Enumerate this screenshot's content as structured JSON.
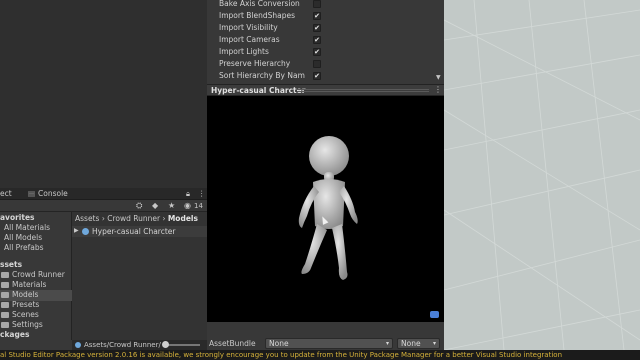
{
  "inspector": {
    "rows": [
      {
        "label": "Bake Axis Conversion",
        "checked": false
      },
      {
        "label": "Import BlendShapes",
        "checked": true
      },
      {
        "label": "Import Visibility",
        "checked": true
      },
      {
        "label": "Import Cameras",
        "checked": true
      },
      {
        "label": "Import Lights",
        "checked": true
      },
      {
        "label": "Preserve Hierarchy",
        "checked": false
      },
      {
        "label": "Sort Hierarchy By Nam",
        "checked": true
      }
    ],
    "check_glyph": "✔"
  },
  "preview": {
    "title": "Hyper-casual Charcter",
    "menu_icon": "⋮",
    "corner_icon": "preview-settings-icon"
  },
  "asset_bundle": {
    "label": "AssetBundle",
    "name_value": "None",
    "variant_value": "None",
    "caret": "▾"
  },
  "project": {
    "tabs": [
      "ect",
      "Console"
    ],
    "toolbar": {
      "visibility_count": "14"
    },
    "tree": {
      "favorites_header": "avorites",
      "favorites": [
        "All Materials",
        "All Models",
        "All Prefabs"
      ],
      "assets_header": "ssets",
      "assets": [
        {
          "label": "Crowd Runner",
          "level": 0
        },
        {
          "label": "Materials",
          "level": 1
        },
        {
          "label": "Models",
          "level": 1,
          "selected": true
        },
        {
          "label": "Presets",
          "level": 1
        },
        {
          "label": "Scenes",
          "level": 1
        },
        {
          "label": "Settings",
          "level": 1
        }
      ],
      "packages_header": "ckages"
    },
    "breadcrumb": [
      "Assets",
      "Crowd Runner",
      "Models"
    ],
    "breadcrumb_sep": "›",
    "file": "Hyper-casual Charcter",
    "path": "Assets/Crowd Runner/"
  },
  "status": {
    "text": "al Studio Editor Package version 2.0.16 is available, we strongly encourage you to update from the Unity Package Manager for a better Visual Studio integration",
    "color": "#d6b23a"
  },
  "colors": {
    "scene_bg": "#c2c9c7",
    "accent": "#4a7fd6"
  }
}
